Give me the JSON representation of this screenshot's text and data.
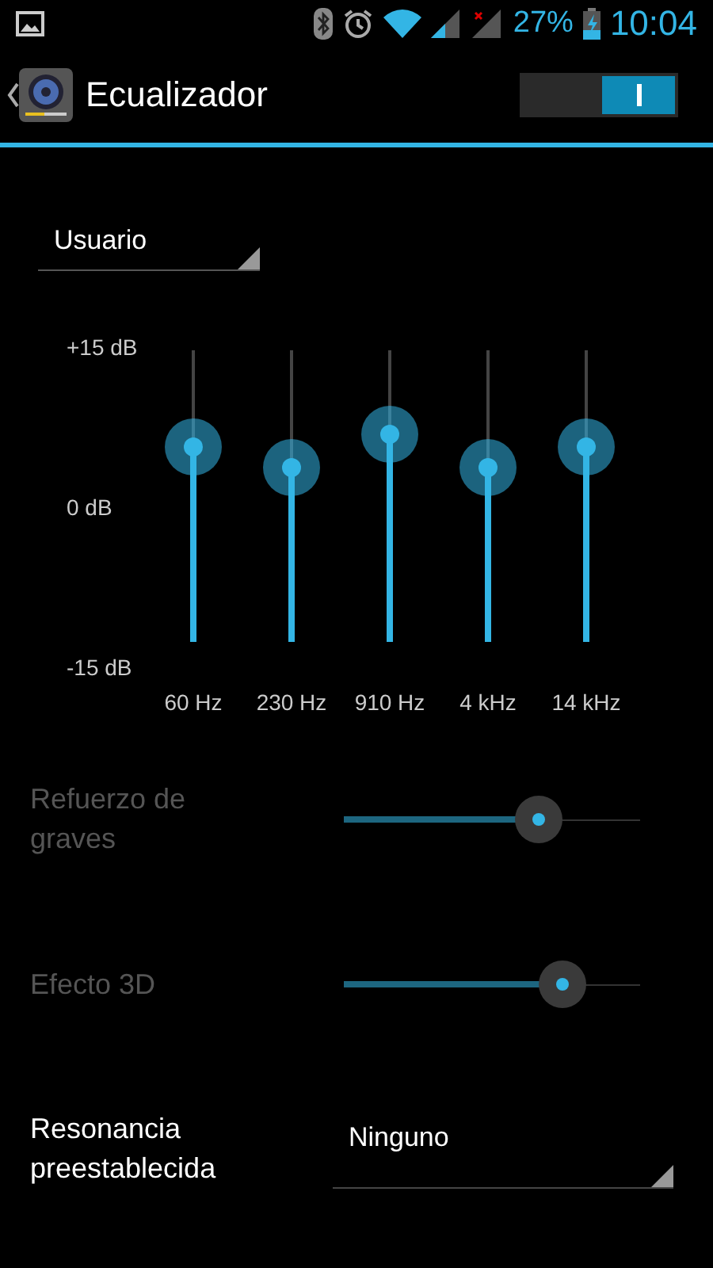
{
  "status_bar": {
    "battery": "27%",
    "time": "10:04"
  },
  "header": {
    "title": "Ecualizador",
    "switch_on": true
  },
  "preset": {
    "value": "Usuario"
  },
  "equalizer": {
    "db_labels": [
      "+15 dB",
      "0 dB",
      "-15 dB"
    ],
    "bands": [
      {
        "label": "60 Hz",
        "level": 0.67
      },
      {
        "label": "230 Hz",
        "level": 0.6
      },
      {
        "label": "910 Hz",
        "level": 0.71
      },
      {
        "label": "4 kHz",
        "level": 0.6
      },
      {
        "label": "14 kHz",
        "level": 0.67
      }
    ]
  },
  "settings": [
    {
      "kind": "slider",
      "label": "Refuerzo de graves",
      "disabled": true,
      "level": 0.66
    },
    {
      "kind": "slider",
      "label": "Efecto 3D",
      "disabled": true,
      "level": 0.74
    },
    {
      "kind": "select",
      "label": "Resonancia preestablecida",
      "disabled": false,
      "value": "Ninguno"
    }
  ]
}
